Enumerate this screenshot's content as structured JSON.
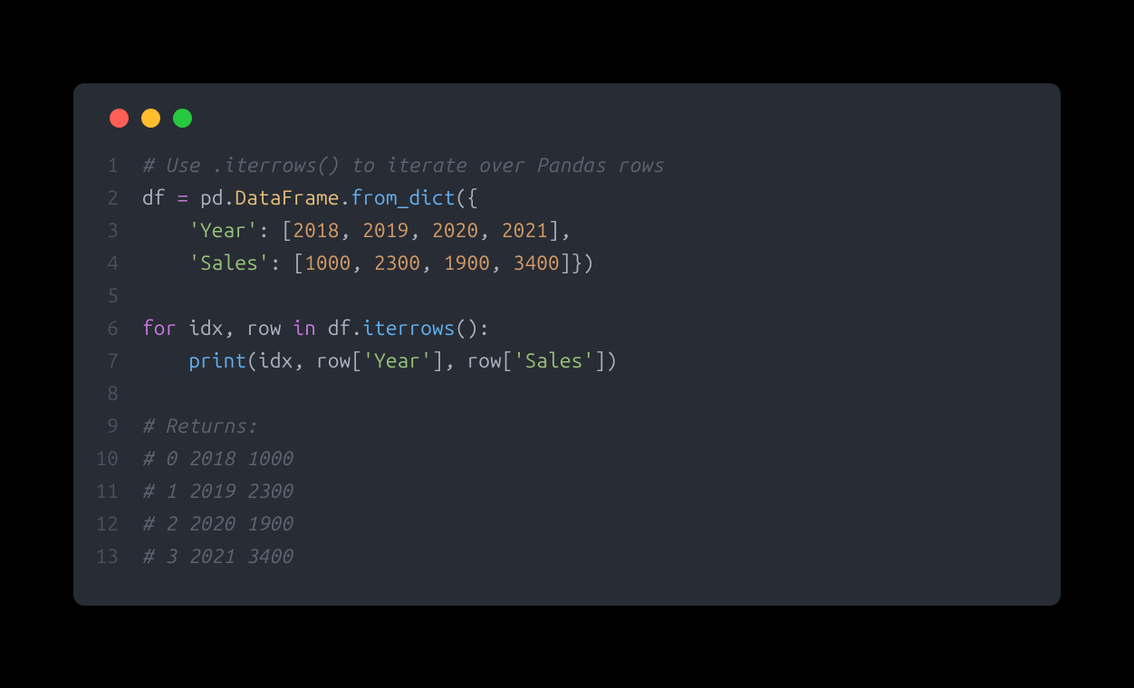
{
  "window": {
    "traffic_lights": [
      "red",
      "yellow",
      "green"
    ]
  },
  "code": {
    "lines": [
      {
        "num": "1",
        "tokens": [
          {
            "cls": "tok-comment",
            "t": "# Use .iterrows() to iterate over Pandas rows"
          }
        ]
      },
      {
        "num": "2",
        "tokens": [
          {
            "cls": "tok-ident",
            "t": "df "
          },
          {
            "cls": "tok-eq",
            "t": "="
          },
          {
            "cls": "tok-ident",
            "t": " pd"
          },
          {
            "cls": "tok-punct",
            "t": "."
          },
          {
            "cls": "tok-obj",
            "t": "DataFrame"
          },
          {
            "cls": "tok-punct",
            "t": "."
          },
          {
            "cls": "tok-func",
            "t": "from_dict"
          },
          {
            "cls": "tok-punct",
            "t": "({"
          }
        ]
      },
      {
        "num": "3",
        "tokens": [
          {
            "cls": "tok-ident",
            "t": "    "
          },
          {
            "cls": "tok-str",
            "t": "'Year'"
          },
          {
            "cls": "tok-punct",
            "t": ": ["
          },
          {
            "cls": "tok-num",
            "t": "2018"
          },
          {
            "cls": "tok-punct",
            "t": ", "
          },
          {
            "cls": "tok-num",
            "t": "2019"
          },
          {
            "cls": "tok-punct",
            "t": ", "
          },
          {
            "cls": "tok-num",
            "t": "2020"
          },
          {
            "cls": "tok-punct",
            "t": ", "
          },
          {
            "cls": "tok-num",
            "t": "2021"
          },
          {
            "cls": "tok-punct",
            "t": "],"
          }
        ]
      },
      {
        "num": "4",
        "tokens": [
          {
            "cls": "tok-ident",
            "t": "    "
          },
          {
            "cls": "tok-str",
            "t": "'Sales'"
          },
          {
            "cls": "tok-punct",
            "t": ": ["
          },
          {
            "cls": "tok-num",
            "t": "1000"
          },
          {
            "cls": "tok-punct",
            "t": ", "
          },
          {
            "cls": "tok-num",
            "t": "2300"
          },
          {
            "cls": "tok-punct",
            "t": ", "
          },
          {
            "cls": "tok-num",
            "t": "1900"
          },
          {
            "cls": "tok-punct",
            "t": ", "
          },
          {
            "cls": "tok-num",
            "t": "3400"
          },
          {
            "cls": "tok-punct",
            "t": "]})"
          }
        ]
      },
      {
        "num": "5",
        "tokens": []
      },
      {
        "num": "6",
        "tokens": [
          {
            "cls": "tok-kw",
            "t": "for"
          },
          {
            "cls": "tok-ident",
            "t": " idx"
          },
          {
            "cls": "tok-punct",
            "t": ", "
          },
          {
            "cls": "tok-ident",
            "t": "row "
          },
          {
            "cls": "tok-kw",
            "t": "in"
          },
          {
            "cls": "tok-ident",
            "t": " df"
          },
          {
            "cls": "tok-punct",
            "t": "."
          },
          {
            "cls": "tok-func",
            "t": "iterrows"
          },
          {
            "cls": "tok-punct",
            "t": "():"
          }
        ]
      },
      {
        "num": "7",
        "tokens": [
          {
            "cls": "tok-ident",
            "t": "    "
          },
          {
            "cls": "tok-builtin",
            "t": "print"
          },
          {
            "cls": "tok-punct",
            "t": "("
          },
          {
            "cls": "tok-ident",
            "t": "idx"
          },
          {
            "cls": "tok-punct",
            "t": ", "
          },
          {
            "cls": "tok-ident",
            "t": "row"
          },
          {
            "cls": "tok-punct",
            "t": "["
          },
          {
            "cls": "tok-str",
            "t": "'Year'"
          },
          {
            "cls": "tok-punct",
            "t": "], "
          },
          {
            "cls": "tok-ident",
            "t": "row"
          },
          {
            "cls": "tok-punct",
            "t": "["
          },
          {
            "cls": "tok-str",
            "t": "'Sales'"
          },
          {
            "cls": "tok-punct",
            "t": "])"
          }
        ]
      },
      {
        "num": "8",
        "tokens": []
      },
      {
        "num": "9",
        "tokens": [
          {
            "cls": "tok-comment",
            "t": "# Returns:"
          }
        ]
      },
      {
        "num": "10",
        "tokens": [
          {
            "cls": "tok-comment",
            "t": "# 0 2018 1000"
          }
        ]
      },
      {
        "num": "11",
        "tokens": [
          {
            "cls": "tok-comment",
            "t": "# 1 2019 2300"
          }
        ]
      },
      {
        "num": "12",
        "tokens": [
          {
            "cls": "tok-comment",
            "t": "# 2 2020 1900"
          }
        ]
      },
      {
        "num": "13",
        "tokens": [
          {
            "cls": "tok-comment",
            "t": "# 3 2021 3400"
          }
        ]
      }
    ]
  }
}
